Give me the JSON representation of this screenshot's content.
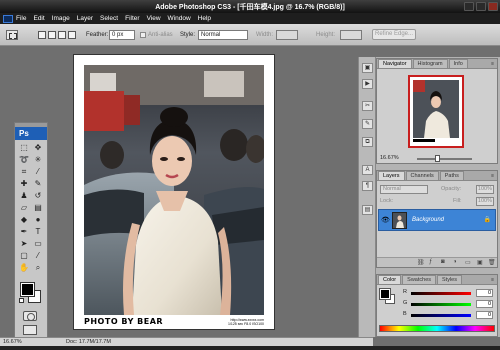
{
  "window": {
    "title": "Adobe Photoshop CS3 - [千田车模4.jpg @ 16.7% (RGB/8)]"
  },
  "menu": {
    "items": [
      "File",
      "Edit",
      "Image",
      "Layer",
      "Select",
      "Filter",
      "View",
      "Window",
      "Help"
    ]
  },
  "options": {
    "feather_label": "Feather:",
    "feather_value": "0 px",
    "antialias_label": "Anti-alias",
    "style_label": "Style:",
    "style_value": "Normal",
    "width_label": "Width:",
    "height_label": "Height:",
    "refine_edge_label": "Refine Edge..."
  },
  "toolbox": {
    "logo": "Ps"
  },
  "document": {
    "caption": "PHOTO BY BEAR",
    "caption_small_line1": "http://www.xxxxx.com",
    "caption_small_line2": "1/125 sec F8.0 ISO100"
  },
  "status": {
    "zoom": "16.67%",
    "doc_info": "Doc: 17.7M/17.7M"
  },
  "navigator": {
    "tabs": [
      "Navigator",
      "Histogram",
      "Info"
    ],
    "zoom": "16.67%"
  },
  "layers": {
    "tabs": [
      "Layers",
      "Channels",
      "Paths"
    ],
    "blend_mode": "Normal",
    "opacity_label": "Opacity:",
    "opacity_value": "100%",
    "lock_label": "Lock:",
    "fill_label": "Fill:",
    "fill_value": "100%",
    "layer_name": "Background"
  },
  "color": {
    "tabs": [
      "Color",
      "Swatches",
      "Styles"
    ],
    "channels": [
      {
        "name": "R",
        "value": "0"
      },
      {
        "name": "G",
        "value": "0"
      },
      {
        "name": "B",
        "value": "0"
      }
    ]
  }
}
